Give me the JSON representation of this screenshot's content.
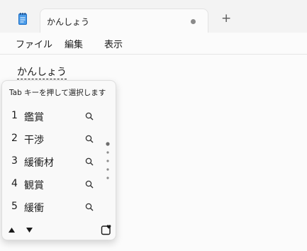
{
  "window": {
    "tab_title": "かんしょう",
    "new_tab_symbol": "+"
  },
  "menu": {
    "items": [
      "ファイル",
      "編集",
      "表示"
    ]
  },
  "editor": {
    "composition_text": "かんしょう"
  },
  "ime": {
    "hint": "Tab キーを押して選択します",
    "candidates": [
      {
        "number": "1",
        "word": "鑑賞"
      },
      {
        "number": "2",
        "word": "干渉"
      },
      {
        "number": "3",
        "word": "緩衝材"
      },
      {
        "number": "4",
        "word": "観賞"
      },
      {
        "number": "5",
        "word": "緩衝"
      }
    ],
    "icons": {
      "search": "search-icon",
      "prev": "triangle-up-icon",
      "next": "triangle-down-icon",
      "favorite": "heart-box-icon"
    }
  },
  "colors": {
    "background": "#f3f3f3",
    "surface": "#fbfbfb",
    "notepad_blue": "#2f7de1"
  }
}
